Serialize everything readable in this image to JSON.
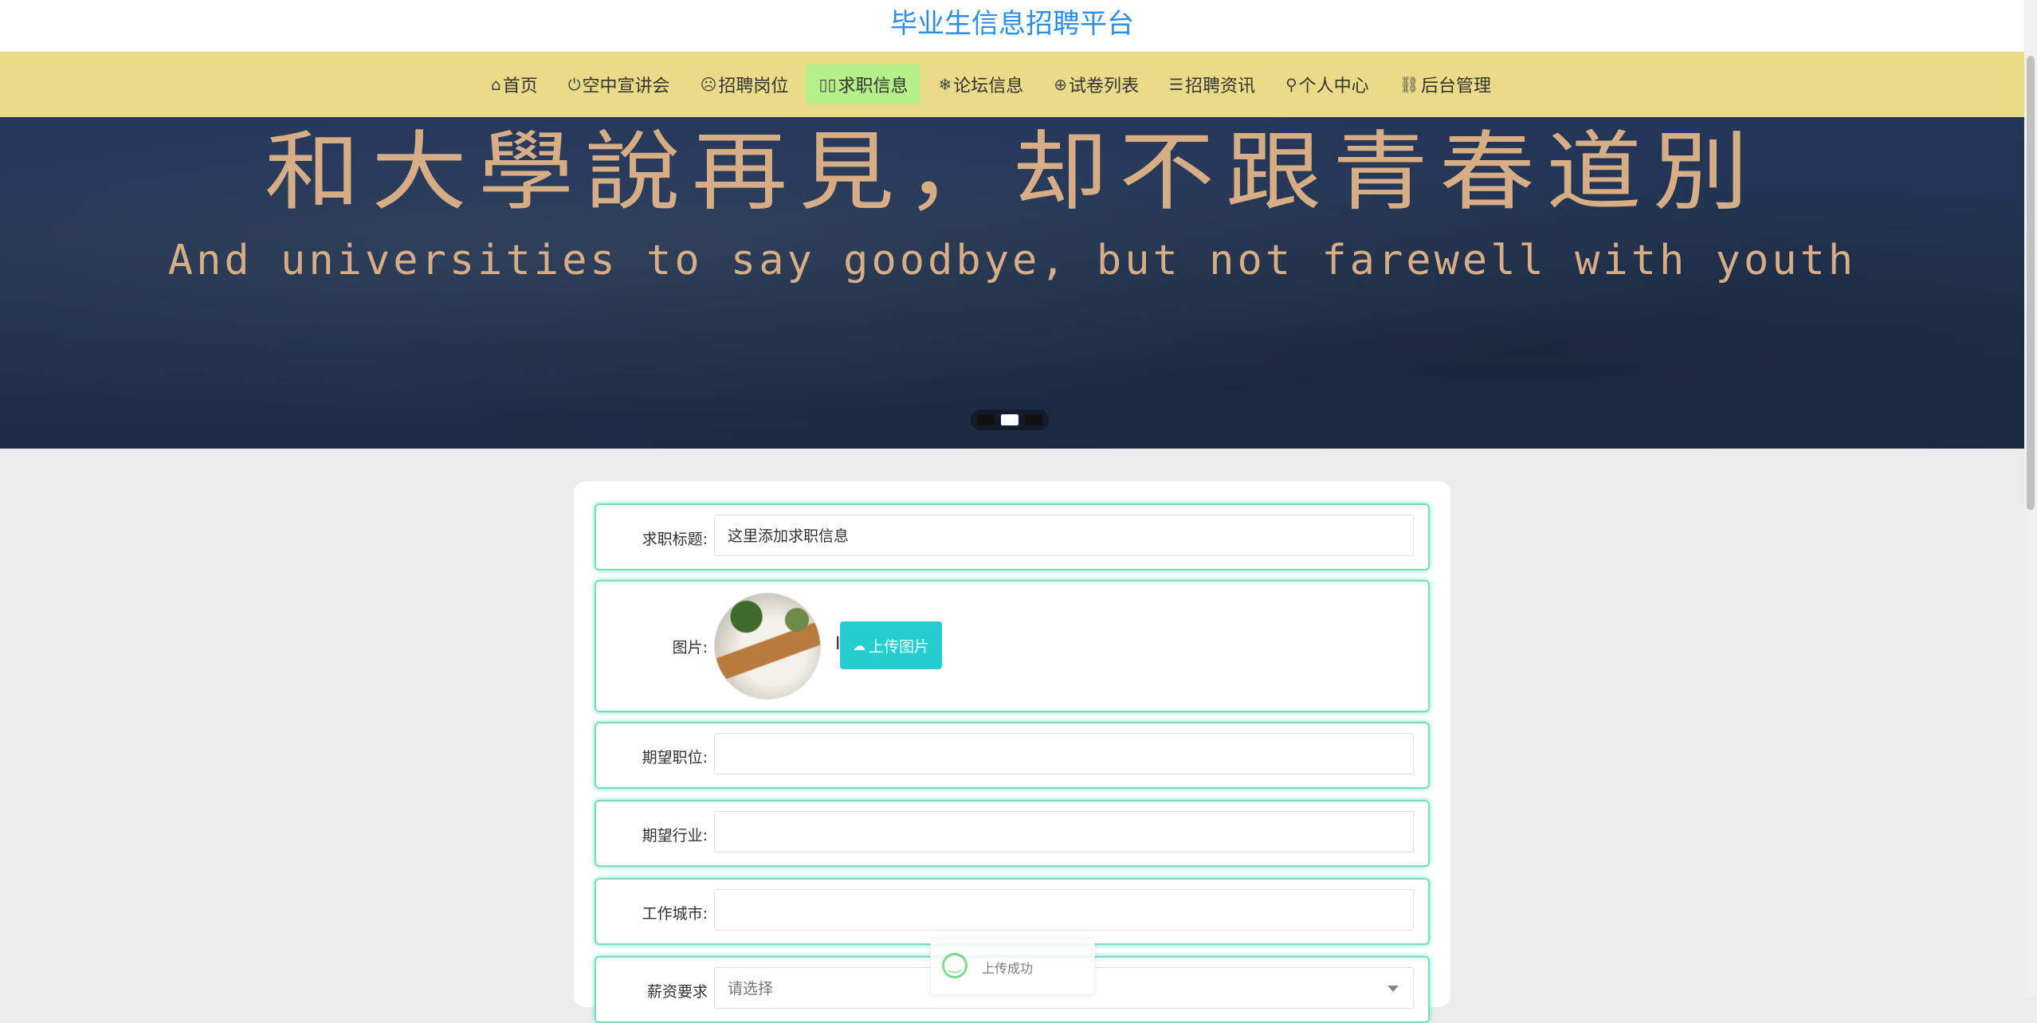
{
  "site": {
    "title": "毕业生信息招聘平台"
  },
  "nav": {
    "items": [
      {
        "label": "首页",
        "icon": "⌂",
        "icon_name": "home-icon"
      },
      {
        "label": "空中宣讲会",
        "icon": "⏻",
        "icon_name": "power-icon"
      },
      {
        "label": "招聘岗位",
        "icon": "☹",
        "icon_name": "face-icon"
      },
      {
        "label": "求职信息",
        "icon": "▯▯",
        "icon_name": "columns-icon",
        "active": true
      },
      {
        "label": "论坛信息",
        "icon": "❄",
        "icon_name": "snowflake-icon"
      },
      {
        "label": "试卷列表",
        "icon": "⊕",
        "icon_name": "globe-icon"
      },
      {
        "label": "招聘资讯",
        "icon": "☰",
        "icon_name": "sliders-icon"
      },
      {
        "label": "个人中心",
        "icon": "⚲",
        "icon_name": "user-icon"
      },
      {
        "label": "后台管理",
        "icon": "⛓",
        "icon_name": "link-icon"
      }
    ]
  },
  "banner": {
    "text_cn": "和大學說再見，却不跟青春道別",
    "text_en": "And universities to say goodbye, but not farewell with youth",
    "slides": 3,
    "active_slide": 2
  },
  "form": {
    "title_label": "求职标题:",
    "title_value": "这里添加求职信息",
    "image_label": "图片:",
    "upload_label": "上传图片",
    "position_label": "期望职位:",
    "position_value": "",
    "industry_label": "期望行业:",
    "industry_value": "",
    "city_label": "工作城市:",
    "city_value": "",
    "salary_label": "薪资要求",
    "salary_placeholder": "请选择"
  },
  "toast": {
    "text": "上传成功"
  }
}
